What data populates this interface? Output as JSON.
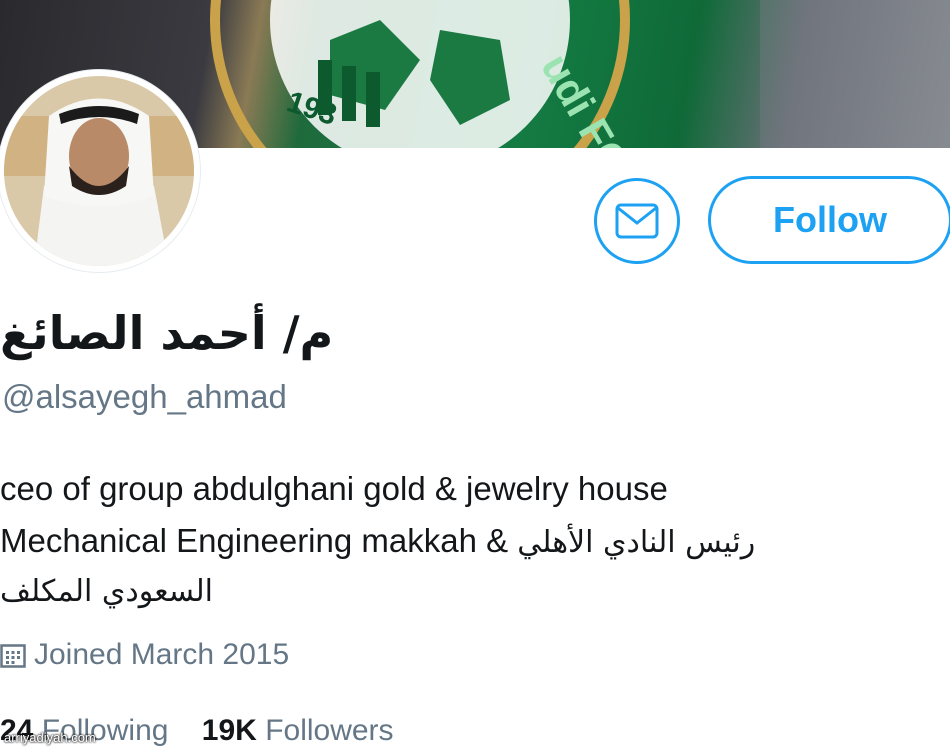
{
  "profile": {
    "display_name": "م/ أحمد الصائغ",
    "handle": "@alsayegh_ahmad",
    "bio": {
      "line1": "ceo of group abdulghani gold & jewelry house",
      "line2_en": "Mechanical Engineering makkah &",
      "line2_ar": "رئيس النادي الأهلي",
      "line3_ar": "السعودي المكلف"
    },
    "joined": "Joined March 2015"
  },
  "actions": {
    "follow_label": "Follow",
    "message_icon": "envelope-icon"
  },
  "stats": {
    "following_count": "24",
    "following_label": "Following",
    "followers_count": "19K",
    "followers_label": "Followers"
  },
  "banner": {
    "logo_text": "udi FC",
    "logo_year": "193"
  },
  "watermark": "arriyadiyah.com",
  "colors": {
    "accent": "#1da1f2",
    "text_primary": "#14171a",
    "text_secondary": "#657786",
    "banner_green": "#157f45"
  }
}
